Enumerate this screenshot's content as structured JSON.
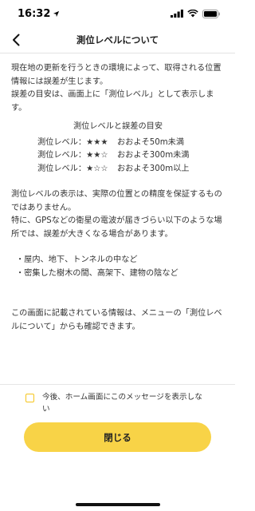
{
  "status_bar": {
    "time": "16:32"
  },
  "nav": {
    "title": "測位レベルについて"
  },
  "intro": {
    "line1": "現在地の更新を行うときの環境によって、取得される位置情報には誤差が生じます。",
    "line2": "誤差の目安は、画面上に「測位レベル」として表示します。"
  },
  "guide": {
    "title": "測位レベルと誤差の目安",
    "rows": [
      {
        "level": "測位レベル：★★★",
        "error": "おおよそ50m未満"
      },
      {
        "level": "測位レベル：★★☆",
        "error": "おおよそ300m未満"
      },
      {
        "level": "測位レベル：★☆☆",
        "error": "おおよそ300m以上"
      }
    ]
  },
  "notice": {
    "line1": "測位レベルの表示は、実際の位置との精度を保証するものではありません。",
    "line2": "特に、GPSなどの衛星の電波が届きづらい以下のような場所では、誤差が大きくなる場合があります。"
  },
  "conditions": [
    "・屋内、地下、トンネルの中など",
    "・密集した樹木の間、高架下、建物の陰など"
  ],
  "footer_note": "この画面に記載されている情報は、メニューの「測位レベルについて」からも確認できます。",
  "checkbox": {
    "label": "今後、ホーム画面にこのメッセージを表示しない",
    "checked": false,
    "color": "#f5c51c"
  },
  "close_button": {
    "label": "閉じる",
    "color": "#f8d347"
  }
}
